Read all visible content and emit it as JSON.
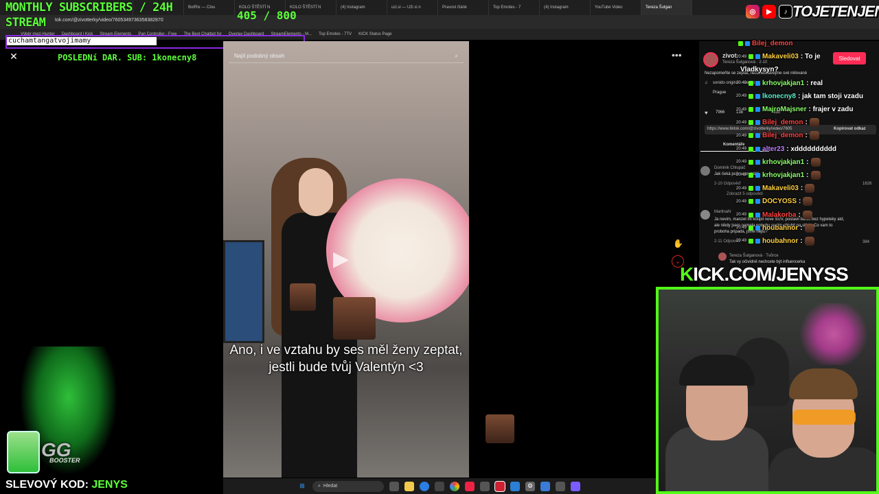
{
  "browser": {
    "tabs": [
      "",
      "",
      "BotRix — Clou",
      "KOLO ŠTĚSTÍ N",
      "KOLO ŠTĚSTÍ N",
      "(4) Instagram",
      "uzi.si — Uži si n",
      "Pravost článk",
      "Top Emotes - 7",
      "(4) Instagram",
      "YouTube Video",
      "Tereza Šulgan"
    ],
    "url": "tok.com/@zivotterky/video/7605349736358382870",
    "bookmarks": [
      "Výběr mezi Hunter",
      "Dashboard | Kick",
      "Stream Elements",
      "Pan Controller - Free",
      "The Best Chatbot for",
      "Overlay Dashboard",
      "StreamElements - M...",
      "Top Emotes - 7TV",
      "KICK Status Page"
    ]
  },
  "overlay": {
    "monthly_line1": "MONTHLY SUBSCRIBERS / 24H",
    "monthly_line2": "STREAM",
    "sub_count": "405  / 800",
    "ticker_text": "cuchamtangatvojimamy",
    "last_sub": "POSLEDNí DAR. SUB: 1konecny8",
    "slevovy_label": "SLEVOVÝ KOD:",
    "slevovy_code": "JENYS",
    "gg": "GG",
    "booster": "BOOSTER",
    "brand": "TOJETENJENYS",
    "kick_k": "K",
    "kick_rest": "ICK.COM/JENYSS"
  },
  "tiktok": {
    "search_placeholder": "Najít podobný obsah",
    "subtitle": "Ano, i ve vztahu by ses měl ženy zeptat, jestli bude tvůj Valentýn <3",
    "author": "zivot",
    "author_sub": "Tereza Šulganová · 2-10",
    "follow_label": "Sledovat",
    "desc_line": "Nezapomeňte se zeptat, nezanedbávejme své milované",
    "sound": "sonido original - aiexito",
    "location": "Prague",
    "likes": "7966",
    "comments": "138",
    "shares": "330",
    "copy_link_label": "Kopírovat odkaz",
    "link_text": "https://www.tiktok.com/@zivotterky/video/7605",
    "comments_tab": "Komentáře",
    "comment1_user": "Dominik Chlupáč",
    "comment1_text": "Jak čeká psík v povzdálí",
    "comment1_meta": "2-10  Odpověď",
    "comment1_likes": "1626",
    "comment1_more": "Zobrazit 5 odpovědí",
    "comment2_user": "MartinaN",
    "comment2_text": "Ja nevim, manzel mi koupil nove SUV, postavil barak bez hypeteky atd, ale nikdy jsem nemela potrebu se tim chlubit na sitich. Co vam to proboha pripadá, jsme hejtu?",
    "comment2_meta": "2-11  Odpověď",
    "comment2_likes": "384",
    "comment3_user": "Tereza Šulganová · Tvůrce",
    "comment3_text": "Tak vy očividně nechcete být influencerka",
    "emote_label": "emote"
  },
  "chat": [
    {
      "time": "",
      "user": "Bilej_demon",
      "color": "#ff4040",
      "text": ""
    },
    {
      "time": "20:49",
      "user": "Makaveli03",
      "color": "#ffd040",
      "text": ": To je"
    },
    {
      "time": "",
      "user": "",
      "color": "#ffffff",
      "text": "Vladkysyn?"
    },
    {
      "time": "20:49",
      "user": "krhovjakjan1",
      "color": "#8aff6a",
      "text": ": real"
    },
    {
      "time": "20:49",
      "user": "lkonecny8",
      "color": "#5cf0d0",
      "text": ": jak tam stoji vzadu"
    },
    {
      "time": "20:49",
      "user": "MajroMajsner",
      "color": "#8aff6a",
      "text": ": frajer v zadu"
    },
    {
      "time": "20:49",
      "user": "Bilej_demon",
      "color": "#ff4040",
      "text": ":"
    },
    {
      "time": "20:49",
      "user": "Bilej_demon",
      "color": "#ff4040",
      "text": ":"
    },
    {
      "time": "20:49",
      "user": "alter23",
      "color": "#c080ff",
      "text": ": xdddddddddd"
    },
    {
      "time": "20:49",
      "user": "krhovjakjan1",
      "color": "#8aff6a",
      "text": ":"
    },
    {
      "time": "20:49",
      "user": "krhovjakjan1",
      "color": "#8aff6a",
      "text": ":"
    },
    {
      "time": "20:49",
      "user": "Makaveli03",
      "color": "#ffd040",
      "text": ":"
    },
    {
      "time": "20:49",
      "user": "DOCYOSS",
      "color": "#ffd040",
      "text": ":"
    },
    {
      "time": "20:49",
      "user": "Malakorba",
      "color": "#ff4040",
      "text": ":"
    },
    {
      "time": "20:49",
      "user": "houbahnor",
      "color": "#ffd040",
      "text": ":"
    },
    {
      "time": "20:49",
      "user": "houbahnor",
      "color": "#ffd040",
      "text": ":"
    }
  ],
  "taskbar": {
    "search_label": "Hledat"
  },
  "colors": {
    "accent_green": "#53fc18",
    "tiktok_red": "#fe2c55",
    "ticker_border": "#8a2be2"
  }
}
